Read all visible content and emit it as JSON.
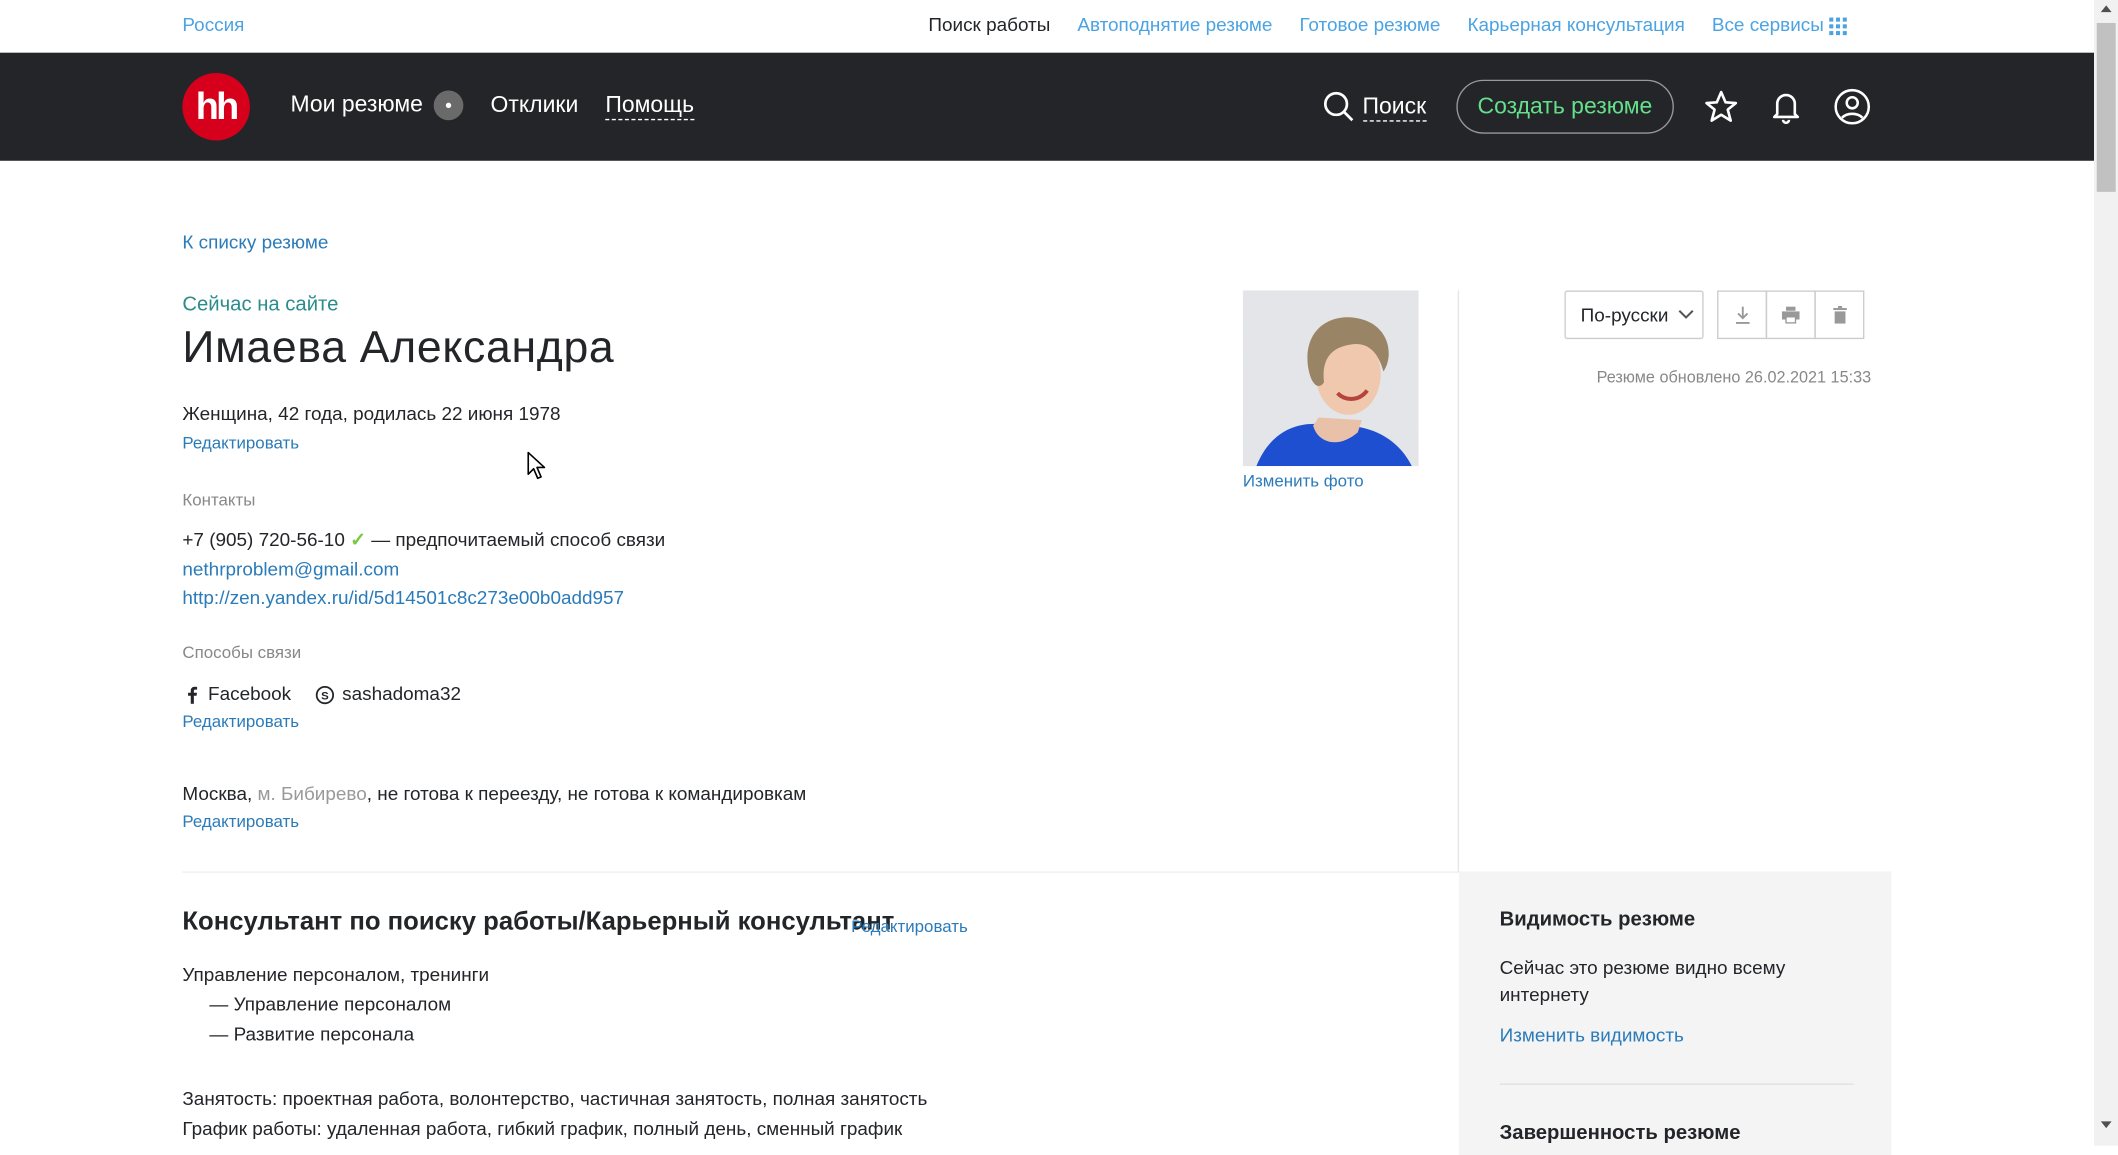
{
  "topbar": {
    "region": "Россия",
    "links": [
      "Поиск работы",
      "Автоподнятие резюме",
      "Готовое резюме",
      "Карьерная консультация",
      "Все сервисы"
    ]
  },
  "nav": {
    "logo": "hh",
    "my_resumes": "Мои резюме",
    "responses": "Отклики",
    "help": "Помощь",
    "search": "Поиск",
    "create_resume": "Создать резюме",
    "icons": [
      "search-icon",
      "star-icon",
      "bell-icon",
      "user-icon"
    ]
  },
  "resume": {
    "back_link": "К списку резюме",
    "online_status": "Сейчас на сайте",
    "name": "Имаева Александра",
    "personal": "Женщина, 42 года, родилась 22 июня 1978",
    "edit": "Редактировать",
    "contacts_label": "Контакты",
    "phone": "+7 (905) 720-56-10",
    "phone_note": "— предпочитаемый способ связи",
    "email": "nethrproblem@gmail.com",
    "website": "http://zen.yandex.ru/id/5d14501c8c273e00b0add957",
    "channels_label": "Способы связи",
    "facebook": "Facebook",
    "skype": "sashadoma32",
    "city": "Москва,",
    "metro": "м. Бибирево",
    "relocation": ", не готова к переезду, не готова к командировкам",
    "change_photo": "Изменить фото",
    "position_title": "Консультант по поиску работы/Карьерный консультант",
    "specialization": "Управление персоналом, тренинги",
    "spec_items": [
      "— Управление персоналом",
      "— Развитие персонала"
    ],
    "employment": "Занятость: проектная работа, волонтерство, частичная занятость, полная занятость",
    "schedule": "График работы: удаленная работа, гибкий график, полный день, сменный график"
  },
  "controls": {
    "language": "По-русски",
    "updated": "Резюме обновлено 26.02.2021 15:33"
  },
  "visibility": {
    "title": "Видимость резюме",
    "text": "Сейчас это резюме видно всему интернету",
    "change_link": "Изменить видимость",
    "completeness_title": "Завершенность резюме"
  },
  "colors": {
    "nav_bg": "#232529",
    "logo_red": "#d6001c",
    "link_blue": "#2b7bb9",
    "create_green": "#65e08a",
    "online_teal": "#2b8c8c"
  }
}
